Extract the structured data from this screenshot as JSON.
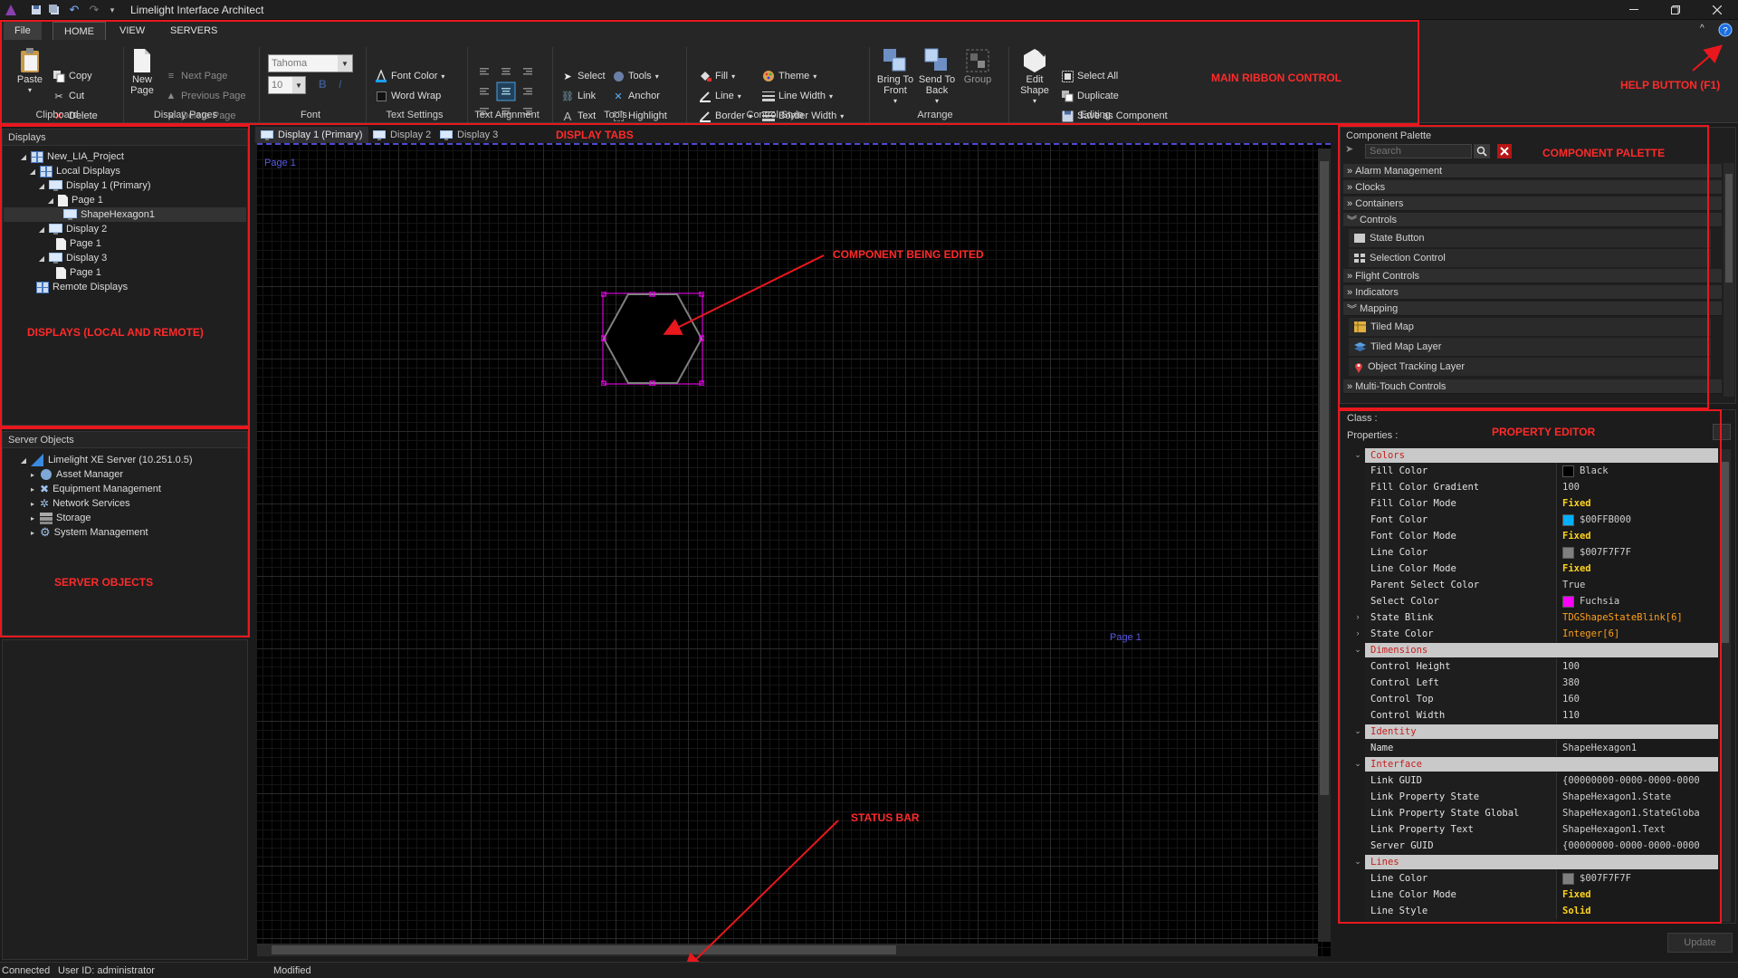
{
  "window": {
    "title": "Limelight Interface Architect"
  },
  "ribbon": {
    "tabs": [
      "File",
      "HOME",
      "VIEW",
      "SERVERS"
    ],
    "clipboard": {
      "label": "Clipboard",
      "paste": "Paste",
      "copy": "Copy",
      "cut": "Cut",
      "delete": "Delete"
    },
    "display_pages": {
      "label": "Display Pages",
      "new_page": "New Page",
      "next_page": "Next Page",
      "previous_page": "Previous Page",
      "delete_page": "Delete Page"
    },
    "font": {
      "label": "Font",
      "family_placeholder": "Tahoma",
      "size_placeholder": "10",
      "bold": "B",
      "italic": "I"
    },
    "text_settings": {
      "label": "Text Settings",
      "font_color": "Font Color",
      "word_wrap": "Word Wrap"
    },
    "text_alignment": {
      "label": "Text Alignment"
    },
    "tools": {
      "label": "Tools",
      "select": "Select",
      "tools": "Tools",
      "link": "Link",
      "anchor": "Anchor",
      "text": "Text",
      "highlight": "Highlight"
    },
    "control_style": {
      "label": "Control Style",
      "fill": "Fill",
      "theme": "Theme",
      "line": "Line",
      "line_width": "Line Width",
      "border": "Border",
      "border_width": "Border Width"
    },
    "arrange": {
      "label": "Arrange",
      "bring_to_front": "Bring To Front",
      "send_to_back": "Send To Back",
      "group": "Group"
    },
    "editing": {
      "label": "Editing",
      "edit_shape": "Edit Shape",
      "select_all": "Select All",
      "duplicate": "Duplicate",
      "save_as_component": "Save as Component"
    }
  },
  "callouts": {
    "main_ribbon": "MAIN RIBBON CONTROL",
    "help_button": "HELP BUTTON (F1)",
    "displays": "DISPLAYS (LOCAL AND REMOTE)",
    "server_objects": "SERVER OBJECTS",
    "display_tabs": "DISPLAY TABS",
    "component_edited": "COMPONENT BEING EDITED",
    "status_bar": "STATUS BAR",
    "component_palette": "COMPONENT PALETTE",
    "property_editor": "PROPERTY EDITOR"
  },
  "displays_panel": {
    "title": "Displays",
    "items": [
      "New_LIA_Project",
      "Local Displays",
      "Display 1 (Primary)",
      "Page 1",
      "ShapeHexagon1",
      "Display 2",
      "Page 1",
      "Display 3",
      "Page 1",
      "Remote Displays"
    ]
  },
  "server_panel": {
    "title": "Server Objects",
    "items": [
      "Limelight XE Server (10.251.0.5)",
      "Asset Manager",
      "Equipment Management",
      "Network Services",
      "Storage",
      "System Management"
    ]
  },
  "display_tabs": [
    "Display 1 (Primary)",
    "Display 2",
    "Display 3"
  ],
  "canvas": {
    "page_label_top": "Page 1",
    "page_label_mid": "Page 1"
  },
  "palette": {
    "title": "Component Palette",
    "search_placeholder": "Search",
    "categories": [
      "Alarm Management",
      "Clocks",
      "Containers",
      "Controls",
      "Flight Controls",
      "Indicators",
      "Mapping",
      "Multi-Touch Controls"
    ],
    "control_items": [
      "State Button",
      "Selection Control"
    ],
    "mapping_items": [
      "Tiled Map",
      "Tiled Map Layer",
      "Object Tracking Layer"
    ]
  },
  "properties": {
    "class_label": "Class :",
    "properties_label": "Properties :",
    "categories": {
      "colors": "Colors",
      "dimensions": "Dimensions",
      "identity": "Identity",
      "interface": "Interface",
      "lines": "Lines"
    },
    "colors": [
      {
        "name": "Fill Color",
        "value": "Black",
        "swatch": "#000000"
      },
      {
        "name": "Fill Color Gradient",
        "value": "100"
      },
      {
        "name": "Fill Color Mode",
        "value": "Fixed"
      },
      {
        "name": "Font Color",
        "value": "$00FFB000",
        "swatch": "#00b0ff"
      },
      {
        "name": "Font Color Mode",
        "value": "Fixed"
      },
      {
        "name": "Line Color",
        "value": "$007F7F7F",
        "swatch": "#7f7f7f"
      },
      {
        "name": "Line Color Mode",
        "value": "Fixed"
      },
      {
        "name": "Parent Select Color",
        "value": "True"
      },
      {
        "name": "Select Color",
        "value": "Fuchsia",
        "swatch": "#ff00ff"
      },
      {
        "name": "State Blink",
        "value": "TDGShapeStateBlink[6]"
      },
      {
        "name": "State Color",
        "value": "Integer[6]"
      }
    ],
    "dimensions": [
      {
        "name": "Control Height",
        "value": "100"
      },
      {
        "name": "Control Left",
        "value": "380"
      },
      {
        "name": "Control Top",
        "value": "160"
      },
      {
        "name": "Control Width",
        "value": "110"
      }
    ],
    "identity": [
      {
        "name": "Name",
        "value": "ShapeHexagon1"
      }
    ],
    "interface": [
      {
        "name": "Link GUID",
        "value": "{00000000-0000-0000-0000"
      },
      {
        "name": "Link Property State",
        "value": "ShapeHexagon1.State"
      },
      {
        "name": "Link Property State Global",
        "value": "ShapeHexagon1.StateGloba"
      },
      {
        "name": "Link Property Text",
        "value": "ShapeHexagon1.Text"
      },
      {
        "name": "Server GUID",
        "value": "{00000000-0000-0000-0000"
      }
    ],
    "lines": [
      {
        "name": "Line Color",
        "value": "$007F7F7F",
        "swatch": "#7f7f7f"
      },
      {
        "name": "Line Color Mode",
        "value": "Fixed"
      },
      {
        "name": "Line Style",
        "value": "Solid"
      }
    ],
    "update_button": "Update"
  },
  "status": {
    "connected": "Connected",
    "user": "User ID: administrator",
    "modified": "Modified"
  },
  "colors": {
    "accent_red": "#e8181e",
    "selection": "#ff00ff",
    "fixed_yellow": "#ffd21e",
    "state_orange": "#ff9f1a"
  }
}
